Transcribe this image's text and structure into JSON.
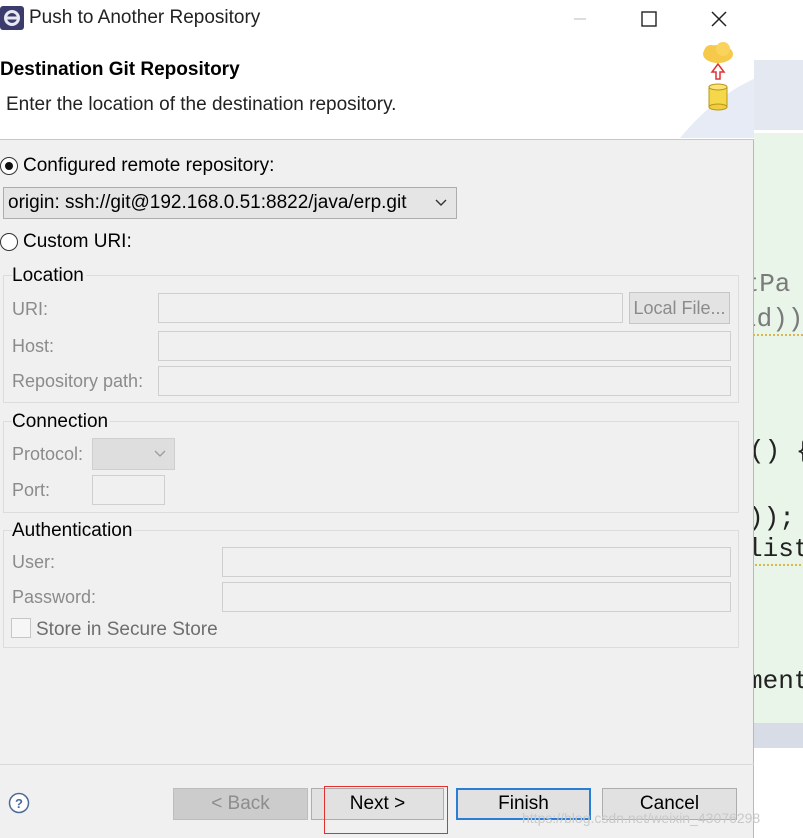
{
  "window": {
    "title": "Push to Another Repository",
    "controls": [
      "minimize-icon",
      "maximize-icon",
      "close-icon"
    ]
  },
  "header": {
    "title": "Destination Git Repository",
    "description": "Enter the location of the destination repository.",
    "art": "cloud-upload-database-icon"
  },
  "source": {
    "configured_label": "Configured remote repository:",
    "configured_selected": true,
    "remote_value": "origin: ssh://git@192.168.0.51:8822/java/erp.git",
    "custom_label": "Custom URI:",
    "custom_selected": false
  },
  "location": {
    "label": "Location",
    "uri_label": "URI:",
    "uri_value": "",
    "local_file_label": "Local File...",
    "host_label": "Host:",
    "host_value": "",
    "repo_path_label": "Repository path:",
    "repo_path_value": ""
  },
  "connection": {
    "label": "Connection",
    "protocol_label": "Protocol:",
    "protocol_value": "",
    "port_label": "Port:",
    "port_value": ""
  },
  "authentication": {
    "label": "Authentication",
    "user_label": "User:",
    "user_value": "",
    "password_label": "Password:",
    "password_value": "",
    "store_label": "Store in Secure Store",
    "store_checked": false
  },
  "footer": {
    "help_icon": "help-icon",
    "back_label": "< Back",
    "next_label": "Next >",
    "finish_label": "Finish",
    "cancel_label": "Cancel"
  },
  "background_editor": {
    "code_lines": [
      "stPa",
      "ld))",
      "() {",
      "));",
      "list",
      "ment"
    ]
  },
  "watermark": "https://blog.csdn.net/weixin_43076298",
  "colors": {
    "accent": "#2a7ed8",
    "highlight_box": "#e03030",
    "editor_tint": "#e8f5e8"
  }
}
